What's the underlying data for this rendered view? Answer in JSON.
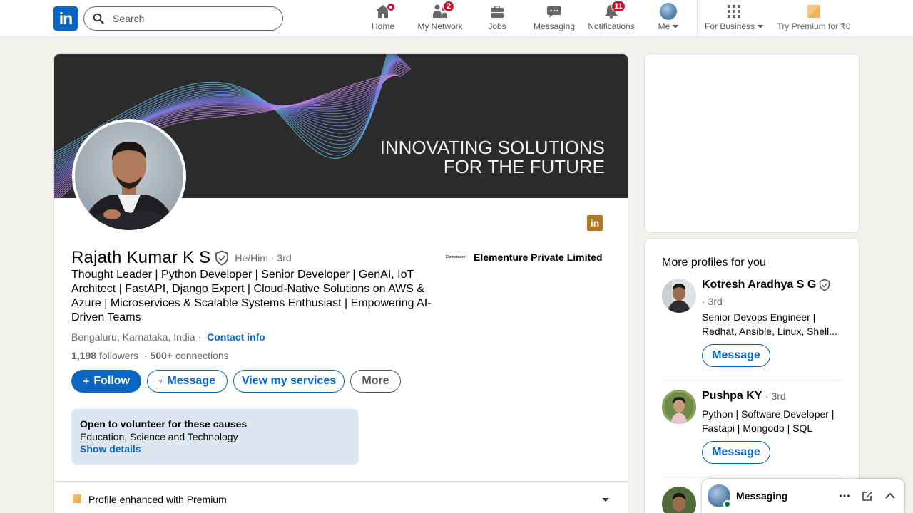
{
  "nav": {
    "logo_text": "in",
    "search_placeholder": "Search",
    "items": [
      {
        "label": "Home",
        "badge": ""
      },
      {
        "label": "My Network",
        "badge": "2"
      },
      {
        "label": "Jobs",
        "badge": ""
      },
      {
        "label": "Messaging",
        "badge": ""
      },
      {
        "label": "Notifications",
        "badge": "11"
      },
      {
        "label": "Me",
        "badge": ""
      },
      {
        "label": "For Business",
        "badge": ""
      },
      {
        "label": "Try Premium for ₹0",
        "badge": ""
      }
    ]
  },
  "banner": {
    "line1": "INNOVATING SOLUTIONS",
    "line2": "FOR THE FUTURE"
  },
  "profile": {
    "name": "Rajath Kumar K S",
    "pronouns_degree": "He/Him · 3rd",
    "headline": "Thought Leader | Python Developer | Senior Developer | GenAI, IoT Architect | FastAPI, Django Expert | Cloud-Native Solutions on AWS & Azure | Microservices & Scalable Systems Enthusiast | Empowering AI-Driven Teams",
    "location": "Bengaluru, Karnataka, India ·",
    "contact_info": "Contact info",
    "followers": "1,198",
    "followers_label": "followers",
    "connections": "500+",
    "connections_label": "connections",
    "company_logo_text": "Elementure",
    "company": "Elementure Private Limited",
    "in_badge": "in"
  },
  "actions": {
    "follow": "Follow",
    "message": "Message",
    "services": "View my services",
    "more": "More"
  },
  "volunteer": {
    "title": "Open to volunteer for these causes",
    "causes": "Education, Science and Technology",
    "link": "Show details"
  },
  "premium_bar": {
    "text": "Profile enhanced with Premium"
  },
  "more_profiles": {
    "header": "More profiles for you",
    "people": [
      {
        "name": "Kotresh Aradhya S G",
        "degree": "· 3rd",
        "desc": "Senior Devops Engineer | Redhat, Ansible, Linux, Shell...",
        "button": "Message"
      },
      {
        "name": "Pushpa KY",
        "degree": "· 3rd",
        "desc": "Python | Software Developer | Fastapi | Mongodb | SQL",
        "button": "Message"
      }
    ]
  },
  "messaging_dock": {
    "title": "Messaging"
  },
  "colors": {
    "brand": "#0a66c2",
    "badge": "#cb112d",
    "premium": "#e7a33e",
    "banner_bg": "#2b2b2b",
    "online": "#01754f"
  }
}
